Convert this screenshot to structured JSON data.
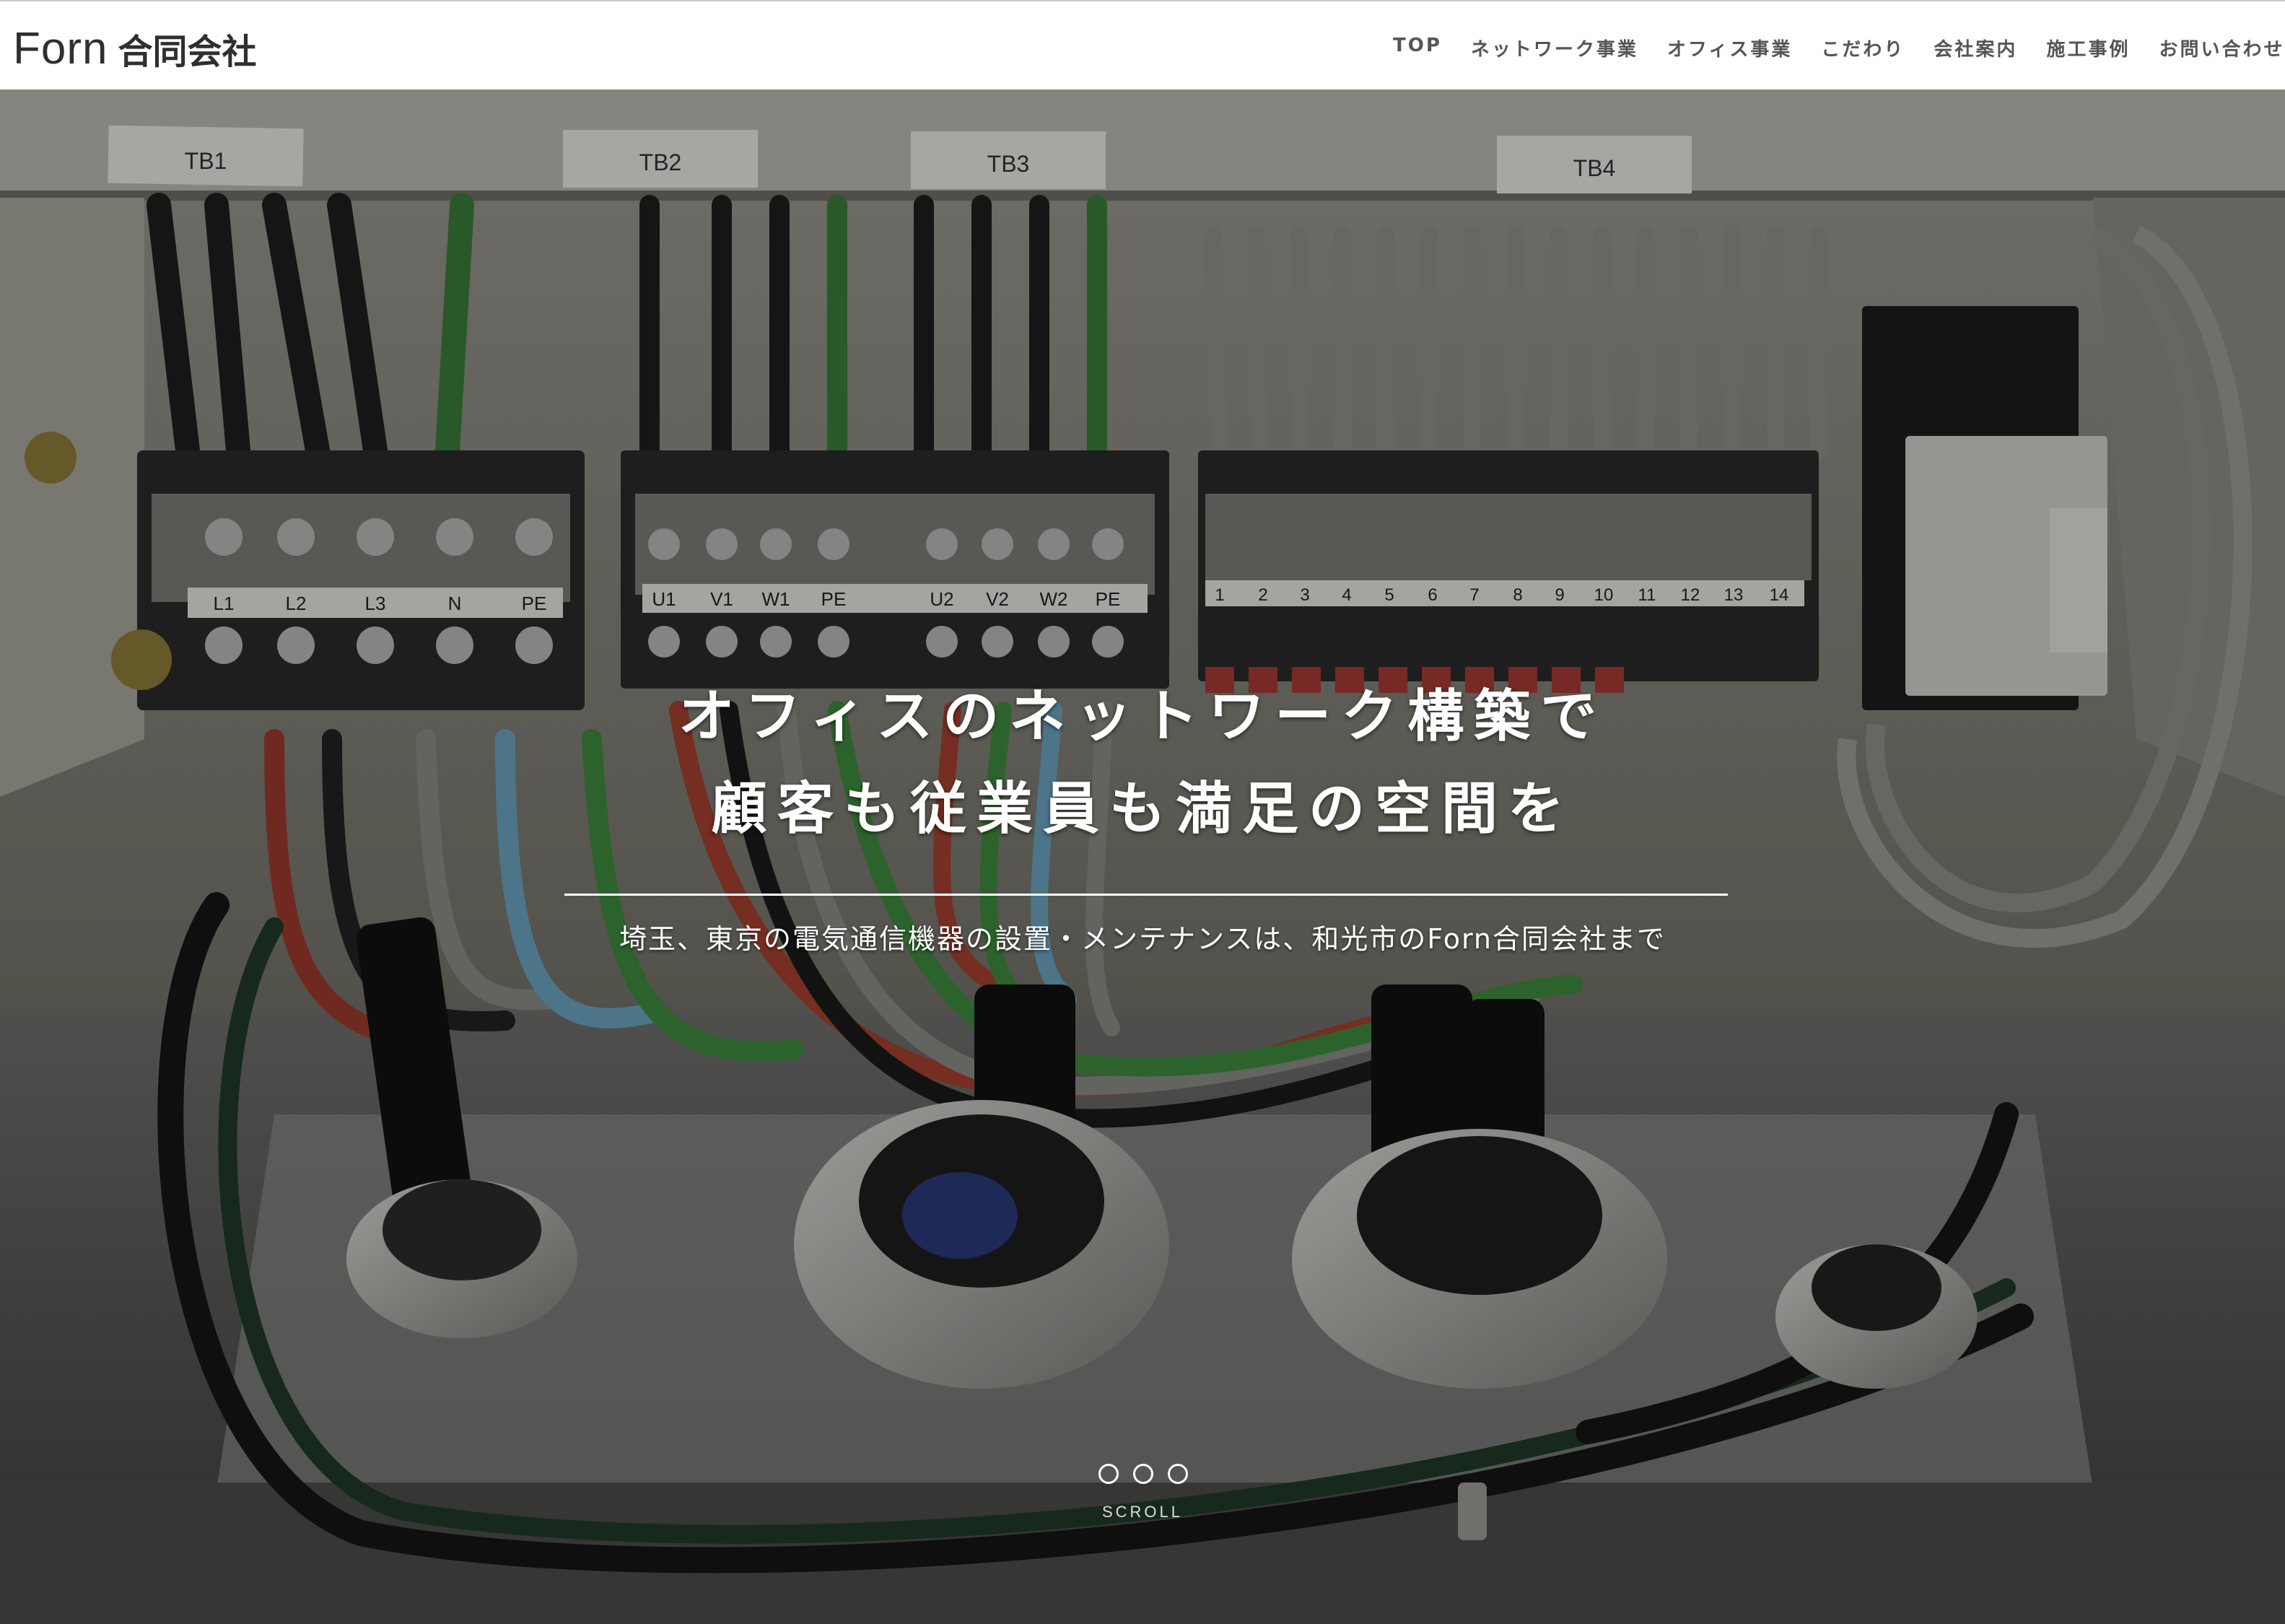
{
  "header": {
    "logo_word": "Forn",
    "logo_suffix": "合同会社",
    "nav": [
      {
        "label": "TOP"
      },
      {
        "label": "ネットワーク事業"
      },
      {
        "label": "オフィス事業"
      },
      {
        "label": "こだわり"
      },
      {
        "label": "会社案内"
      },
      {
        "label": "施工事例"
      },
      {
        "label": "お問い合わせ"
      }
    ]
  },
  "hero": {
    "headline_line1": "オフィスのネットワーク構築で",
    "headline_line2": "顧客も従業員も満足の空間を",
    "subtitle": "埼玉、東京の電気通信機器の設置・メンテナンスは、和光市のForn合同会社まで",
    "photo_labels": {
      "tb1": "TB1",
      "tb2": "TB2",
      "tb3": "TB3",
      "tb4": "TB4",
      "terms_tb1": [
        "L1",
        "L2",
        "L3",
        "N",
        "PE"
      ],
      "terms_tb2": [
        "U1",
        "V1",
        "W1",
        "PE"
      ],
      "terms_tb3": [
        "U2",
        "V2",
        "W2",
        "PE"
      ],
      "terms_tb4": [
        "1",
        "2",
        "3",
        "4",
        "5",
        "6",
        "7",
        "8",
        "9",
        "10",
        "11",
        "12",
        "13",
        "14"
      ]
    },
    "slider_dot_count": 3,
    "scroll_label": "SCROLL"
  },
  "colors": {
    "header_bg": "#ffffff",
    "nav_text": "#555555",
    "logo_text": "#2f2f2f",
    "hero_text": "#ffffff"
  }
}
